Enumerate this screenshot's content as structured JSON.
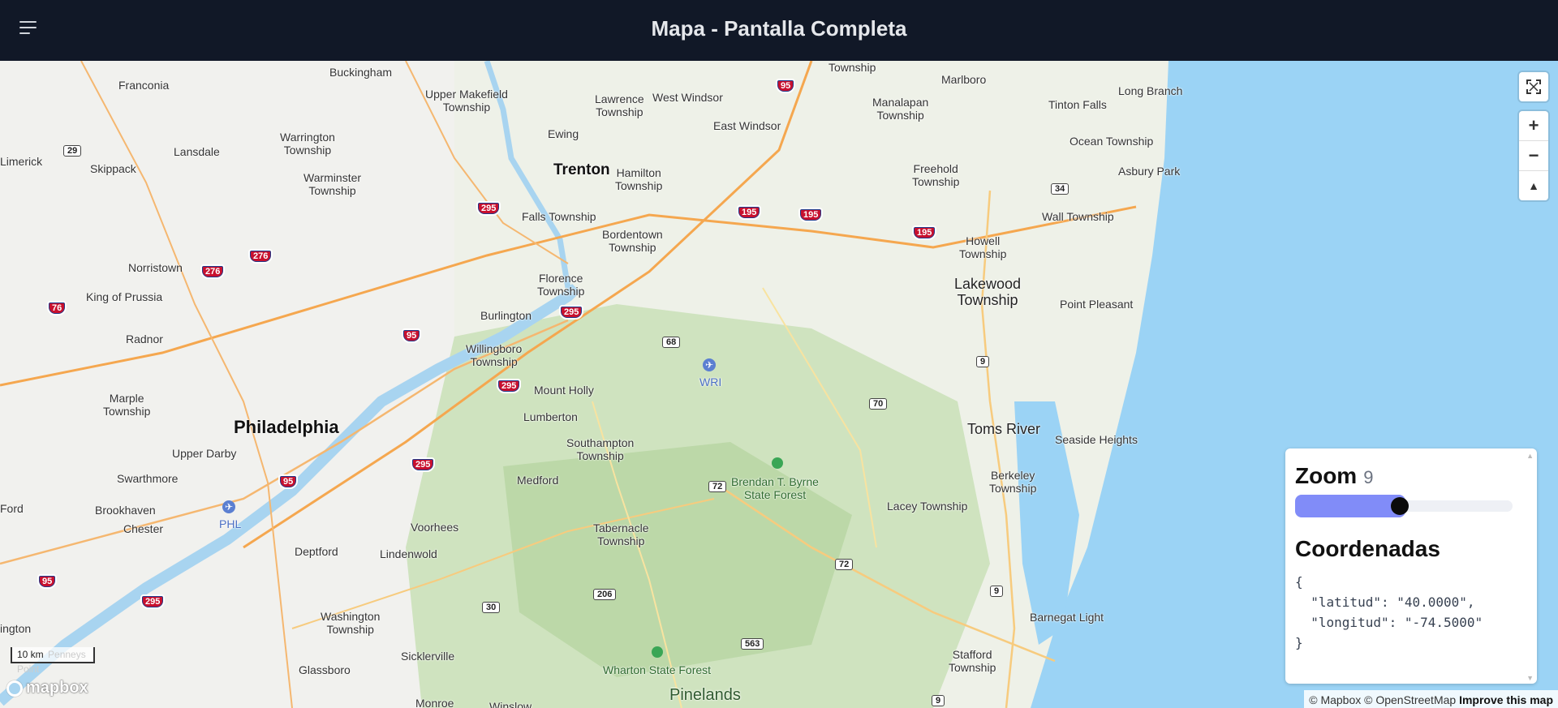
{
  "header": {
    "title": "Mapa - Pantalla Completa",
    "menu_icon": "hamburger-menu-icon"
  },
  "map": {
    "labels_major": [
      {
        "text": "Philadelphia",
        "name": "city-philadelphia"
      },
      {
        "text": "Trenton",
        "name": "city-trenton"
      }
    ],
    "labels_medium": [
      {
        "text": "Toms River",
        "name": "town-toms-river"
      },
      {
        "text": "Lakewood\nTownship",
        "name": "town-lakewood"
      },
      {
        "text": "Pinelands",
        "name": "region-pinelands"
      }
    ],
    "labels_minor": [
      "Buckingham",
      "Franconia",
      "Upper Makefield\nTownship",
      "Lawrence\nTownship",
      "West Windsor",
      "Township",
      "Marlboro",
      "Tinton Falls",
      "Long Branch",
      "Manalapan\nTownship",
      "East Windsor",
      "Ewing",
      "Warrington\nTownship",
      "Lansdale",
      "Limerick",
      "Skippack",
      "Warminster\nTownship",
      "Hamilton\nTownship",
      "Freehold\nTownship",
      "Ocean Township",
      "Asbury Park",
      "Falls Township",
      "Bordentown\nTownship",
      "Howell\nTownship",
      "Wall Township",
      "Norristown",
      "King of Prussia",
      "Florence\nTownship",
      "Burlington",
      "Point Pleasant",
      "Radnor",
      "Willingboro\nTownship",
      "Mount Holly",
      "Marple\nTownship",
      "Lumberton",
      "Southampton\nTownship",
      "Upper Darby",
      "Seaside Heights",
      "Swarthmore",
      "Medford",
      "Berkeley\nTownship",
      "Brookhaven",
      "Lacey Township",
      "Chester",
      "Voorhees",
      "Tabernacle\nTownship",
      "Lindenwold",
      "Deptford",
      "Washington\nTownship",
      "Barnegat Light",
      "Sicklerville",
      "Glassboro",
      "Stafford\nTownship",
      "Monroe",
      "Winslow",
      "Ford",
      "ington"
    ],
    "labels_green": [
      {
        "text": "Brendan T. Byrne\nState Forest",
        "name": "park-brendan-byrne"
      },
      {
        "text": "Wharton State Forest",
        "name": "park-wharton"
      }
    ],
    "labels_blue": [
      {
        "text": "WRI",
        "name": "airport-wri"
      },
      {
        "text": "PHL",
        "name": "airport-phl"
      }
    ],
    "interstate_shields": [
      "95",
      "295",
      "195",
      "195",
      "195",
      "276",
      "276",
      "76",
      "95",
      "295",
      "295",
      "295",
      "95",
      "295",
      "95"
    ],
    "route_shields": [
      "29",
      "34",
      "68",
      "9",
      "70",
      "72",
      "72",
      "9",
      "30",
      "206",
      "563",
      "9"
    ],
    "controls": {
      "fullscreen": "fullscreen-icon",
      "zoom_in": "+",
      "zoom_out": "−",
      "compass": "▲"
    },
    "scale_label": "10 km",
    "scale_underlay": "Penneys Point",
    "logo_text": "mapbox",
    "attribution": {
      "text": "© Mapbox © OpenStreetMap",
      "improve": "Improve this map"
    }
  },
  "panel": {
    "zoom_title": "Zoom",
    "zoom_value": "9",
    "zoom_fraction": 0.5,
    "coords_title": "Coordenadas",
    "coords_json": "{\n  \"latitud\": \"40.0000\",\n  \"longitud\": \"-74.5000\"\n}"
  }
}
